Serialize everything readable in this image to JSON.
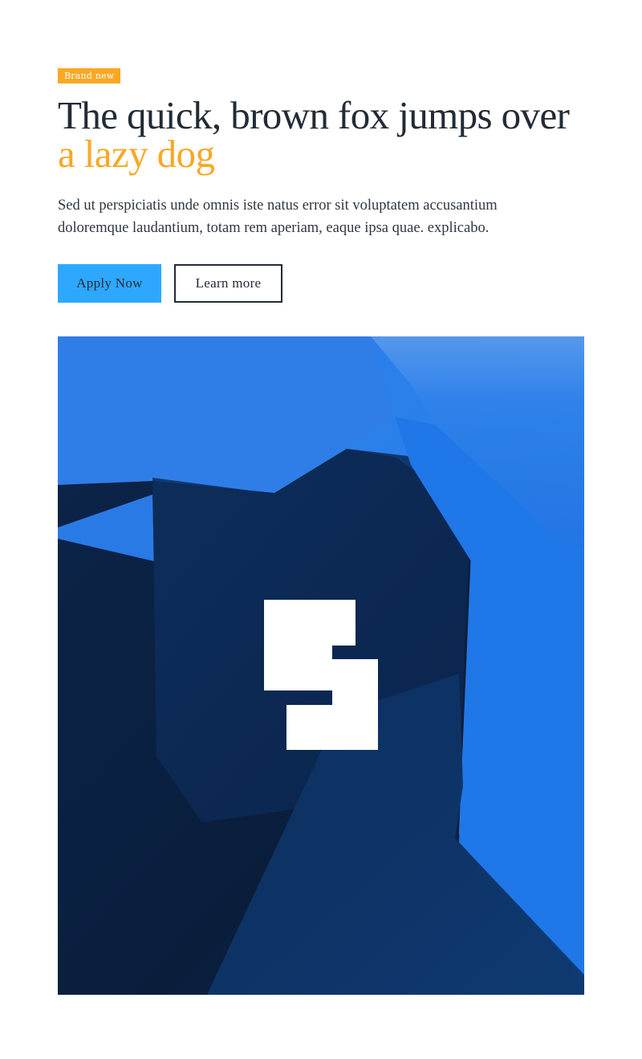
{
  "hero": {
    "badge": "Brand new",
    "headline_main": "The quick, brown fox jumps over",
    "headline_accent": "a lazy dog",
    "lead": "Sed ut perspiciatis unde omnis iste natus error sit voluptatem accusantium doloremque laudantium, totam rem aperiam, eaque ipsa quae. explicabo.",
    "primary_button": "Apply Now",
    "secondary_button": "Learn more"
  },
  "image": {
    "logo": "square-steps-logo",
    "colors": {
      "dark": "#0b1d36",
      "mid": "#0e3a73",
      "bright": "#1f75e6",
      "light": "#5b9bec"
    }
  },
  "colors": {
    "accent": "#f9a825",
    "primary": "#2ea8ff",
    "text": "#222b36"
  }
}
